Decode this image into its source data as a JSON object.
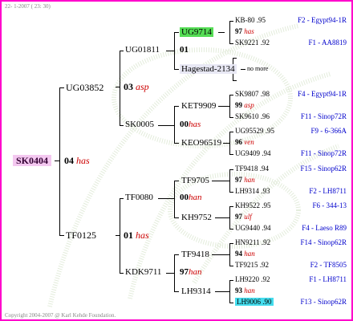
{
  "header": {
    "date": "22- 1-2007 ( 23: 30)"
  },
  "footer": {
    "copyright": "Copyright 2004-2007 @ Karl Kehde Foundation."
  },
  "colors": {
    "frame": "#ff00cc",
    "subject_highlight": "#f4c8f0",
    "green_highlight": "#55dd55",
    "blue_highlight": "#44ddee",
    "race_text": "#0000cc",
    "note_text": "#cc0000"
  },
  "subject": {
    "ring": "SK0404",
    "number": "04",
    "kind": "has"
  },
  "sire": {
    "ring": "UG03852",
    "number": "03",
    "kind": "asp"
  },
  "dam": {
    "ring": "TF0125",
    "number": "01",
    "kind": "has"
  },
  "gen3": [
    {
      "ring": "UG01811",
      "number": "01",
      "kind": ""
    },
    {
      "ring": "SK0005",
      "number": "00",
      "kind": "has"
    },
    {
      "ring": "TF0080",
      "number": "00",
      "kind": "han"
    },
    {
      "ring": "KDK9711",
      "number": "97",
      "kind": "han"
    }
  ],
  "gen35": [
    {
      "ring": "UG9714"
    },
    {
      "ring": "Hagestad-2134"
    },
    {
      "ring": "KET9909"
    },
    {
      "ring": "KEO96519"
    },
    {
      "ring": "TF9705"
    },
    {
      "ring": "KH9752"
    },
    {
      "ring": "TF9418"
    },
    {
      "ring": "LH9314"
    }
  ],
  "gen4": [
    {
      "ring": "KB-80",
      "score": ".95"
    },
    {
      "number": "97",
      "kind": "has"
    },
    {
      "ring": "SK9221",
      "score": ".92"
    },
    {
      "note": "no more"
    },
    {
      "ring": "SK9807",
      "score": ".98"
    },
    {
      "number": "99",
      "kind": "asp"
    },
    {
      "ring": "SK9610",
      "score": ".96"
    },
    {
      "ring": "UG95529",
      "score": ".95"
    },
    {
      "number": "96",
      "kind": "ven"
    },
    {
      "ring": "UG9409",
      "score": ".94"
    },
    {
      "ring": "TF9418",
      "score": ".94"
    },
    {
      "number": "97",
      "kind": "han"
    },
    {
      "ring": "LH9314",
      "score": ".93"
    },
    {
      "ring": "KH9522",
      "score": ".95"
    },
    {
      "number": "97",
      "kind": "ulf"
    },
    {
      "ring": "UG9440",
      "score": ".94"
    },
    {
      "ring": "HN9211",
      "score": ".92"
    },
    {
      "number": "94",
      "kind": "han"
    },
    {
      "ring": "TF9215",
      "score": ".92"
    },
    {
      "ring": "LH9220",
      "score": ".92"
    },
    {
      "number": "93",
      "kind": "han"
    },
    {
      "ring": "LH9006",
      "score": ".90"
    }
  ],
  "races": [
    "F2 - Egypt94-1R",
    "F1 - AA8819",
    "F4 - Egypt94-1R",
    "F11 - Sinop72R",
    "F9 - 6-366A",
    "F11 - Sinop72R",
    "F15 - Sinop62R",
    "F2 - LH8711",
    "F6 - 344-13",
    "F4 - Laeso R89",
    "F14 - Sinop62R",
    "F2 - TF8505",
    "F1 - LH8711",
    "F13 - Sinop62R"
  ]
}
